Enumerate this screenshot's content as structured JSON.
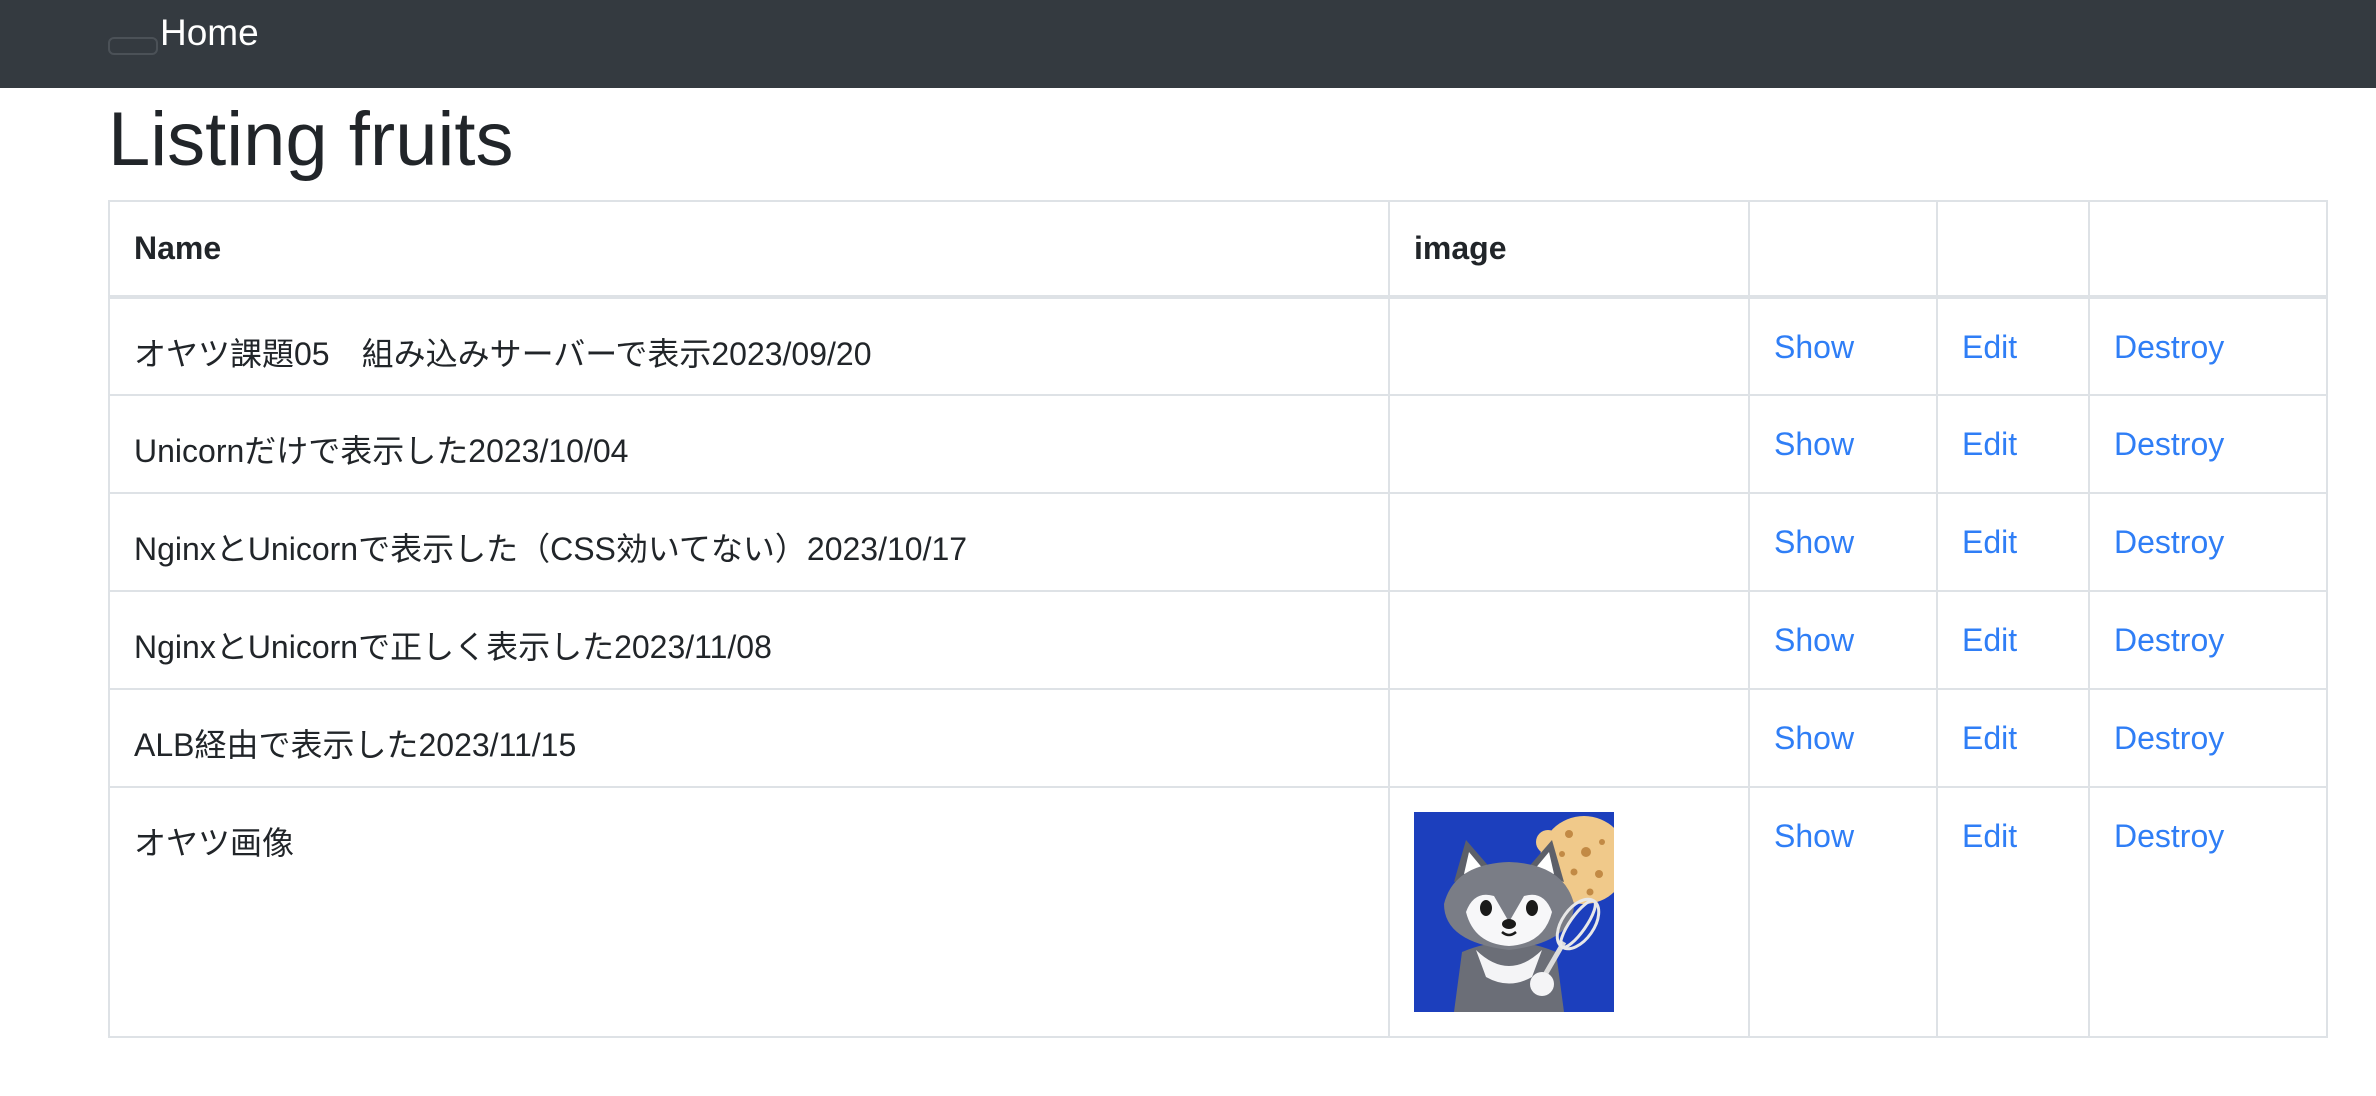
{
  "navbar": {
    "brand": "Home"
  },
  "page": {
    "title": "Listing fruits"
  },
  "table": {
    "headers": {
      "name": "Name",
      "image": "image"
    },
    "rows": [
      {
        "name": "オヤツ課題05　組み込みサーバーで表示2023/09/20",
        "show": "Show",
        "edit": "Edit",
        "destroy": "Destroy"
      },
      {
        "name": "Unicornだけで表示した2023/10/04",
        "show": "Show",
        "edit": "Edit",
        "destroy": "Destroy"
      },
      {
        "name": "NginxとUnicornで表示した（CSS効いてない）2023/10/17",
        "show": "Show",
        "edit": "Edit",
        "destroy": "Destroy"
      },
      {
        "name": "NginxとUnicornで正しく表示した2023/11/08",
        "show": "Show",
        "edit": "Edit",
        "destroy": "Destroy"
      },
      {
        "name": "ALB経由で表示した2023/11/15",
        "show": "Show",
        "edit": "Edit",
        "destroy": "Destroy"
      },
      {
        "name": "オヤツ画像",
        "image_icon": "raccoon-chef-icon",
        "show": "Show",
        "edit": "Edit",
        "destroy": "Destroy"
      }
    ]
  },
  "colors": {
    "navbar": "#343a40",
    "link": "#2f7ef6",
    "thumb_background": "#1c3fbd"
  }
}
